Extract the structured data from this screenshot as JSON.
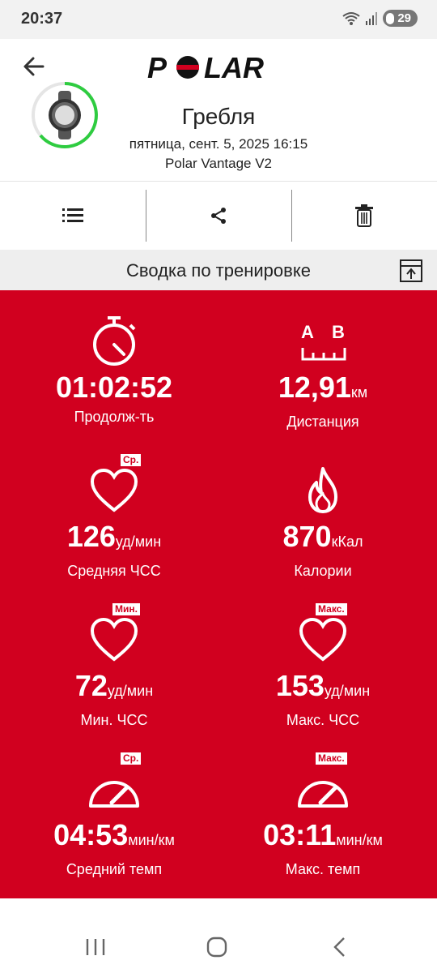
{
  "status": {
    "time": "20:37",
    "battery": "29"
  },
  "header": {
    "brand": "POLAR",
    "sport": "Гребля",
    "date": "пятница, сент. 5, 2025 16:15",
    "device": "Polar Vantage V2"
  },
  "summary": {
    "title": "Сводка по тренировке"
  },
  "stats": {
    "duration": {
      "value": "01:02:52",
      "unit": "",
      "label": "Продолж-ть"
    },
    "distance": {
      "value": "12,91",
      "unit": "км",
      "label": "Дистанция",
      "icon_a": "A",
      "icon_b": "B"
    },
    "avg_hr": {
      "value": "126",
      "unit": "уд/мин",
      "label": "Средняя ЧСС",
      "tag": "Ср."
    },
    "calories": {
      "value": "870",
      "unit": "кКал",
      "label": "Калории"
    },
    "min_hr": {
      "value": "72",
      "unit": "уд/мин",
      "label": "Мин. ЧСС",
      "tag": "Мин."
    },
    "max_hr": {
      "value": "153",
      "unit": "уд/мин",
      "label": "Макс. ЧСС",
      "tag": "Макс."
    },
    "avg_pace": {
      "value": "04:53",
      "unit": "мин/км",
      "label": "Средний темп",
      "tag": "Ср."
    },
    "max_pace": {
      "value": "03:11",
      "unit": "мин/км",
      "label": "Макс. темп",
      "tag": "Макс."
    }
  },
  "colors": {
    "accent": "#d1001f",
    "progress": "#2ecc40"
  }
}
